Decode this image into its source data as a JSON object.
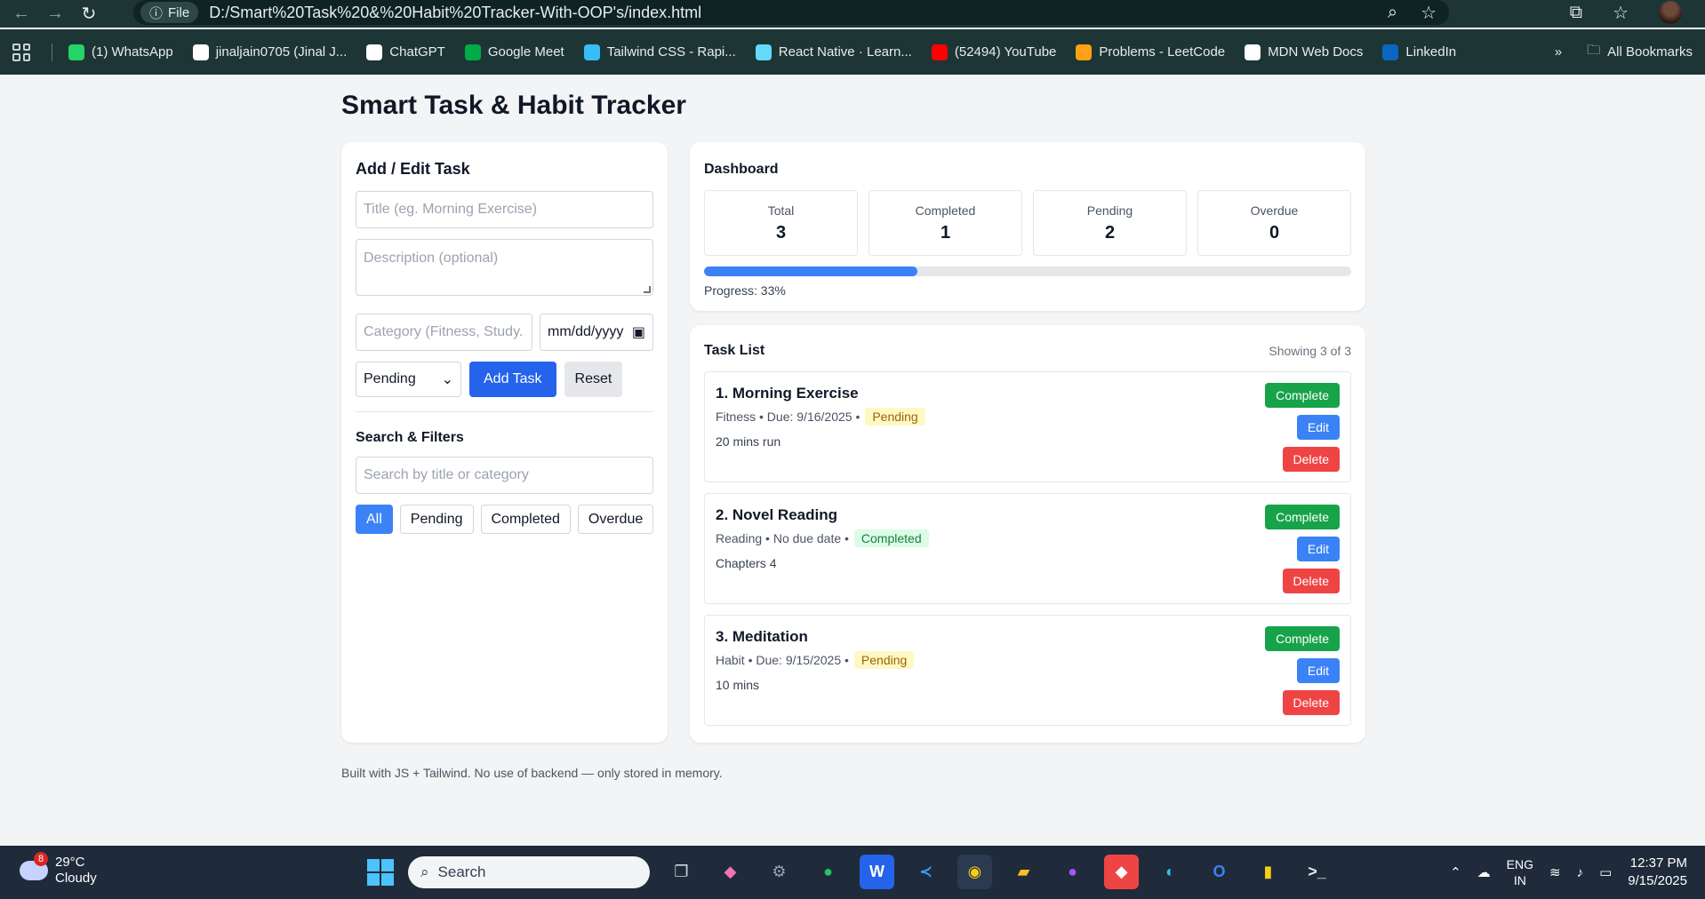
{
  "browser": {
    "file_chip": "File",
    "url": "D:/Smart%20Task%20&%20Habit%20Tracker-With-OOP's/index.html",
    "bookmarks": [
      {
        "label": "(1) WhatsApp",
        "icon": "whatsapp-icon",
        "color": "#25d366"
      },
      {
        "label": "jinaljain0705 (Jinal J...",
        "icon": "github-icon",
        "color": "#ffffff"
      },
      {
        "label": "ChatGPT",
        "icon": "chatgpt-icon",
        "color": "#ffffff"
      },
      {
        "label": "Google Meet",
        "icon": "google-meet-icon",
        "color": "#00ac47"
      },
      {
        "label": "Tailwind CSS - Rapi...",
        "icon": "tailwind-icon",
        "color": "#38bdf8"
      },
      {
        "label": "React Native · Learn...",
        "icon": "react-icon",
        "color": "#61dafb"
      },
      {
        "label": "(52494) YouTube",
        "icon": "youtube-icon",
        "color": "#ff0000"
      },
      {
        "label": "Problems - LeetCode",
        "icon": "leetcode-icon",
        "color": "#ffa116"
      },
      {
        "label": "MDN Web Docs",
        "icon": "mdn-icon",
        "color": "#ffffff"
      },
      {
        "label": "LinkedIn",
        "icon": "linkedin-icon",
        "color": "#0a66c2"
      }
    ],
    "all_bookmarks": "All Bookmarks"
  },
  "app": {
    "title": "Smart Task & Habit Tracker",
    "form": {
      "heading": "Add / Edit Task",
      "title_placeholder": "Title (eg. Morning Exercise)",
      "description_placeholder": "Description (optional)",
      "category_placeholder": "Category (Fitness, Study...)",
      "date_value": "mm/dd/yyyy",
      "status_selected": "Pending",
      "add_label": "Add Task",
      "reset_label": "Reset"
    },
    "filters": {
      "heading": "Search & Filters",
      "search_placeholder": "Search by title or category",
      "buttons": [
        "All",
        "Pending",
        "Completed",
        "Overdue"
      ],
      "active": "All"
    },
    "dashboard": {
      "heading": "Dashboard",
      "stats": [
        {
          "label": "Total",
          "value": "3"
        },
        {
          "label": "Completed",
          "value": "1"
        },
        {
          "label": "Pending",
          "value": "2"
        },
        {
          "label": "Overdue",
          "value": "0"
        }
      ],
      "progress_percent": 33,
      "progress_label": "Progress: 33%",
      "accent": "#3b82f6"
    },
    "task_list": {
      "heading": "Task List",
      "showing": "Showing 3 of 3",
      "tasks": [
        {
          "title": "1. Morning Exercise",
          "meta": "Fitness • Due: 9/16/2025 •",
          "status": "Pending",
          "desc": "20 mins run"
        },
        {
          "title": "2. Novel Reading",
          "meta": "Reading • No due date •",
          "status": "Completed",
          "desc": "Chapters 4"
        },
        {
          "title": "3. Meditation",
          "meta": "Habit • Due: 9/15/2025 •",
          "status": "Pending",
          "desc": "10 mins"
        }
      ],
      "actions": {
        "complete": "Complete",
        "edit": "Edit",
        "delete": "Delete"
      }
    },
    "footer": "Built with JS + Tailwind. No use of backend — only stored in memory."
  },
  "taskbar": {
    "temp": "29°C",
    "weather": "Cloudy",
    "weather_badge": "8",
    "search": "Search",
    "lang_top": "ENG",
    "lang_bottom": "IN",
    "time": "12:37 PM",
    "date": "9/15/2025"
  }
}
